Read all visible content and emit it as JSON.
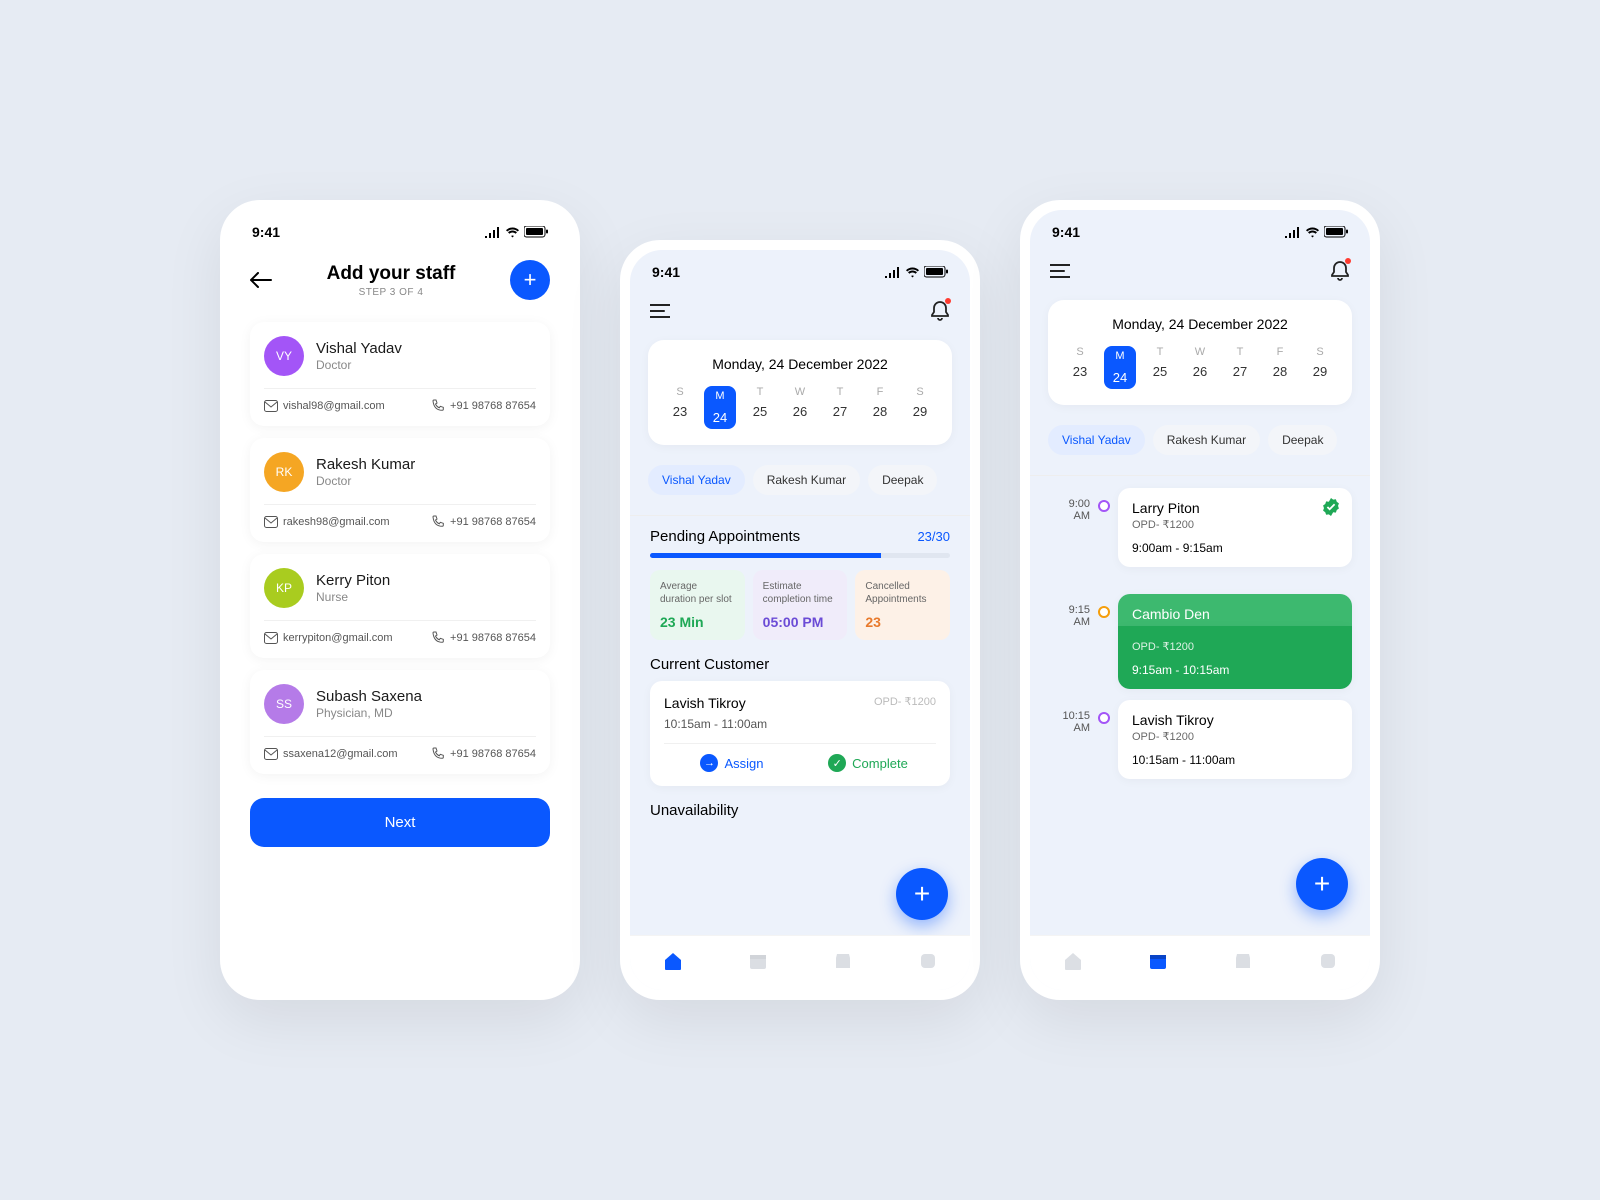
{
  "status": {
    "time": "9:41"
  },
  "screen1": {
    "title": "Add your staff",
    "step": "STEP 3 OF 4",
    "next": "Next",
    "staff": [
      {
        "initials": "VY",
        "color": "#a355f7",
        "name": "Vishal Yadav",
        "role": "Doctor",
        "email": "vishal98@gmail.com",
        "phone": "+91 98768 87654"
      },
      {
        "initials": "RK",
        "color": "#f5a623",
        "name": "Rakesh Kumar",
        "role": "Doctor",
        "email": "rakesh98@gmail.com",
        "phone": "+91 98768 87654"
      },
      {
        "initials": "KP",
        "color": "#a9cc1f",
        "name": "Kerry Piton",
        "role": "Nurse",
        "email": "kerrypiton@gmail.com",
        "phone": "+91 98768 87654"
      },
      {
        "initials": "SS",
        "color": "#b57be8",
        "name": "Subash Saxena",
        "role": "Physician, MD",
        "email": "ssaxena12@gmail.com",
        "phone": "+91 98768 87654"
      }
    ]
  },
  "calendar": {
    "title": "Monday, 24 December 2022",
    "days": [
      {
        "dow": "S",
        "num": "23"
      },
      {
        "dow": "M",
        "num": "24",
        "active": true
      },
      {
        "dow": "T",
        "num": "25"
      },
      {
        "dow": "W",
        "num": "26"
      },
      {
        "dow": "T",
        "num": "27"
      },
      {
        "dow": "F",
        "num": "28"
      },
      {
        "dow": "S",
        "num": "29"
      }
    ]
  },
  "staffChips": [
    "Vishal Yadav",
    "Rakesh Kumar",
    "Deepak"
  ],
  "screen2": {
    "pending": {
      "title": "Pending Appointments",
      "count": "23/30"
    },
    "stats": [
      {
        "label": "Average duration per slot",
        "val": "23 Min",
        "cls": "stat-green"
      },
      {
        "label": "Estimate completion time",
        "val": "05:00 PM",
        "cls": "stat-purple"
      },
      {
        "label": "Cancelled Appointments",
        "val": "23",
        "cls": "stat-orange"
      }
    ],
    "currentTitle": "Current Customer",
    "current": {
      "name": "Lavish Tikroy",
      "tag": "OPD- ₹1200",
      "time": "10:15am - 11:00am",
      "assign": "Assign",
      "complete": "Complete"
    },
    "unavail": "Unavailability"
  },
  "screen3": {
    "appts": [
      {
        "t1": "9:00",
        "t2": "AM",
        "dot": "dot-purple",
        "name": "Larry Piton",
        "meta": "OPD- ₹1200",
        "time": "9:00am - 9:15am",
        "verified": true
      },
      {
        "t1": "9:15",
        "t2": "AM",
        "dot": "dot-orange",
        "name": "Cambio Den",
        "meta": "OPD- ₹1200",
        "time": "9:15am - 10:15am",
        "green": true
      },
      {
        "t1": "10:15",
        "t2": "AM",
        "dot": "dot-purple",
        "name": "Lavish Tikroy",
        "meta": "OPD- ₹1200",
        "time": "10:15am - 11:00am"
      }
    ]
  }
}
